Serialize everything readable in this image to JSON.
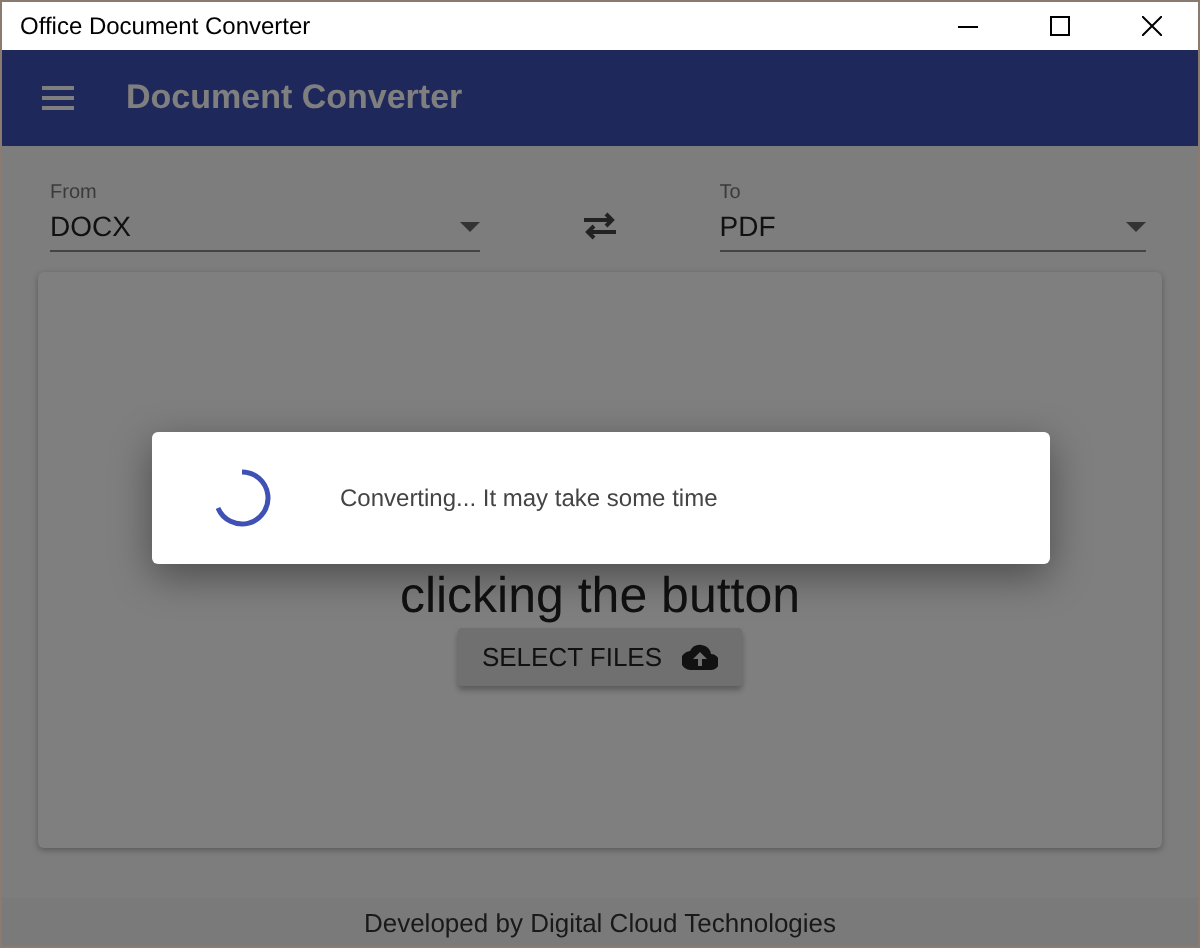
{
  "window": {
    "title": "Office Document Converter"
  },
  "app_bar": {
    "title": "Document Converter"
  },
  "from": {
    "label": "From",
    "value": "DOCX"
  },
  "to": {
    "label": "To",
    "value": "PDF"
  },
  "drop_area": {
    "hint": "clicking the button",
    "button": "SELECT FILES"
  },
  "dialog": {
    "message": "Converting... It may take some time"
  },
  "footer": {
    "text": "Developed by Digital Cloud Technologies"
  }
}
